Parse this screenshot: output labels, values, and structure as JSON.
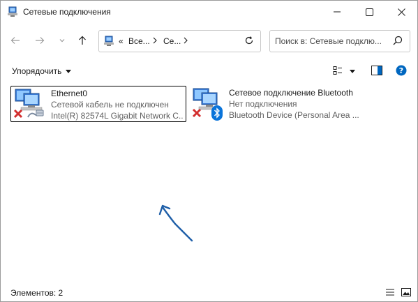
{
  "window": {
    "title": "Сетевые подключения",
    "controls": {
      "minimize": "minimize-icon",
      "maximize": "maximize-icon",
      "close": "close-icon"
    }
  },
  "nav": {
    "back": "arrow-left-icon",
    "forward": "arrow-right-icon",
    "recent": "chevron-down-icon",
    "up": "arrow-up-icon",
    "address": {
      "overflow": "«",
      "segments": [
        "Все...",
        "Се..."
      ]
    },
    "search_placeholder": "Поиск в: Сетевые подклю..."
  },
  "toolbar": {
    "organize_label": "Упорядочить"
  },
  "connections": [
    {
      "name": "Ethernet0",
      "status": "Сетевой кабель не подключен",
      "device": "Intel(R) 82574L Gigabit Network C...",
      "selected": true,
      "overlay": "ethernet-cable-icon",
      "error": "red-x-icon"
    },
    {
      "name": "Сетевое подключение Bluetooth",
      "status": "Нет подключения",
      "device": "Bluetooth Device (Personal Area ...",
      "selected": false,
      "overlay": "bluetooth-icon",
      "error": "red-x-icon"
    }
  ],
  "status_bar": {
    "item_count": "Элементов: 2"
  },
  "annotation": {
    "color": "#1f5fa8",
    "icon": "pointer-arrow-icon"
  },
  "colors": {
    "accent": "#0067c0",
    "error": "#d32f2f",
    "bluetooth": "#0a74da"
  }
}
